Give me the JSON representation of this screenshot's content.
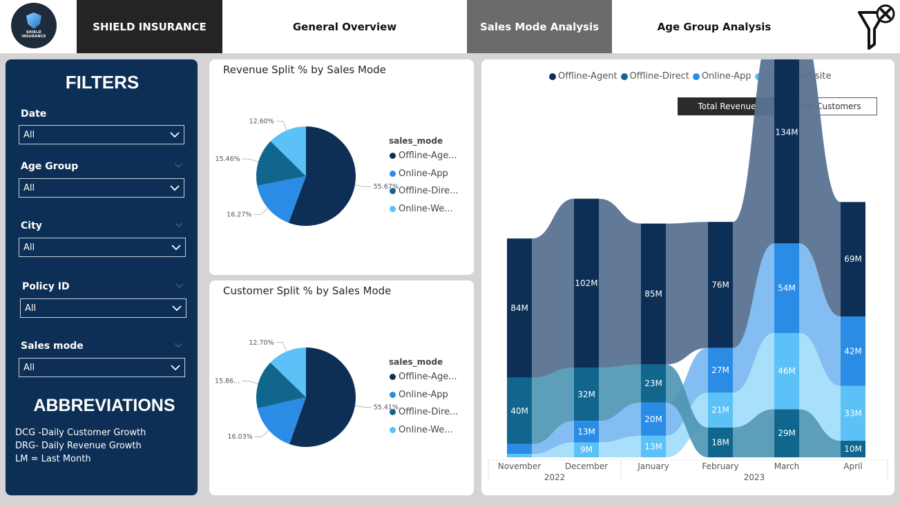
{
  "header": {
    "logo_text": "SHIELD INSURANCE",
    "tabs": [
      {
        "label": "SHIELD INSURANCE"
      },
      {
        "label": "General Overview"
      },
      {
        "label": "Sales Mode Analysis"
      },
      {
        "label": "Age Group Analysis"
      }
    ],
    "active_tab": "Sales Mode Analysis"
  },
  "filters": {
    "title": "FILTERS",
    "items": [
      {
        "label": "Date",
        "value": "All"
      },
      {
        "label": "Age Group",
        "value": "All"
      },
      {
        "label": "City",
        "value": "All"
      },
      {
        "label": "Policy ID",
        "value": "All"
      },
      {
        "label": "Sales mode",
        "value": "All"
      }
    ]
  },
  "abbreviations": {
    "title": "ABBREVIATIONS",
    "items": [
      "DCG -Daily Customer Growth",
      "DRG- Daily Revenue Growth",
      "LM = Last Month"
    ]
  },
  "colors": {
    "offline_agent": "#0d2f55",
    "offline_direct": "#11668e",
    "online_app": "#2b8ce6",
    "online_website": "#5bc1f7"
  },
  "revenue_split": {
    "title": "Revenue Split % by Sales Mode",
    "legend_title": "sales_mode",
    "legend": [
      "Offline-Age...",
      "Online-App",
      "Offline-Dire...",
      "Online-We..."
    ]
  },
  "customer_split": {
    "title": "Customer Split % by Sales Mode",
    "legend_title": "sales_mode",
    "legend": [
      "Offline-Age...",
      "Online-App",
      "Offline-Dire...",
      "Online-We..."
    ]
  },
  "ribbon": {
    "legend": [
      "Offline-Agent",
      "Offline-Direct",
      "Online-App",
      "Online-Website"
    ],
    "toggles": [
      "Total Revenue",
      "Total Customers"
    ],
    "active_toggle": "Total Revenue",
    "year_2022": "2022",
    "year_2023": "2023"
  },
  "chart_data": [
    {
      "type": "pie",
      "title": "Revenue Split % by Sales Mode",
      "labels": [
        "Offline-Agent",
        "Online-App",
        "Offline-Direct",
        "Online-Website"
      ],
      "values": [
        55.67,
        16.27,
        15.46,
        12.6
      ],
      "value_labels": [
        "55.67%",
        "16.27%",
        "15.46%",
        "12.60%"
      ]
    },
    {
      "type": "pie",
      "title": "Customer Split % by Sales Mode",
      "labels": [
        "Offline-Agent",
        "Online-App",
        "Offline-Direct",
        "Online-Website"
      ],
      "values": [
        55.41,
        16.03,
        15.86,
        12.7
      ],
      "value_labels": [
        "55.41%",
        "16.03%",
        "15.86...",
        "12.70%"
      ]
    },
    {
      "type": "bar",
      "subtype": "ribbon",
      "categories": [
        "November",
        "December",
        "January",
        "February",
        "March",
        "April"
      ],
      "series": [
        {
          "name": "Offline-Agent",
          "values": [
            84,
            102,
            85,
            76,
            134,
            69
          ],
          "labels": [
            "84M",
            "102M",
            "85M",
            "76M",
            "134M",
            "69M"
          ]
        },
        {
          "name": "Offline-Direct",
          "values": [
            40,
            32,
            23,
            18,
            29,
            10
          ],
          "labels": [
            "40M",
            "32M",
            "23M",
            "18M",
            "29M",
            "10M"
          ]
        },
        {
          "name": "Online-App",
          "values": [
            6,
            13,
            20,
            27,
            54,
            42
          ],
          "labels": [
            "",
            "13M",
            "20M",
            "27M",
            "54M",
            "42M"
          ]
        },
        {
          "name": "Online-Website",
          "values": [
            2,
            9,
            13,
            21,
            46,
            33
          ],
          "labels": [
            "",
            "9M",
            "13M",
            "21M",
            "46M",
            "33M"
          ]
        }
      ]
    }
  ]
}
